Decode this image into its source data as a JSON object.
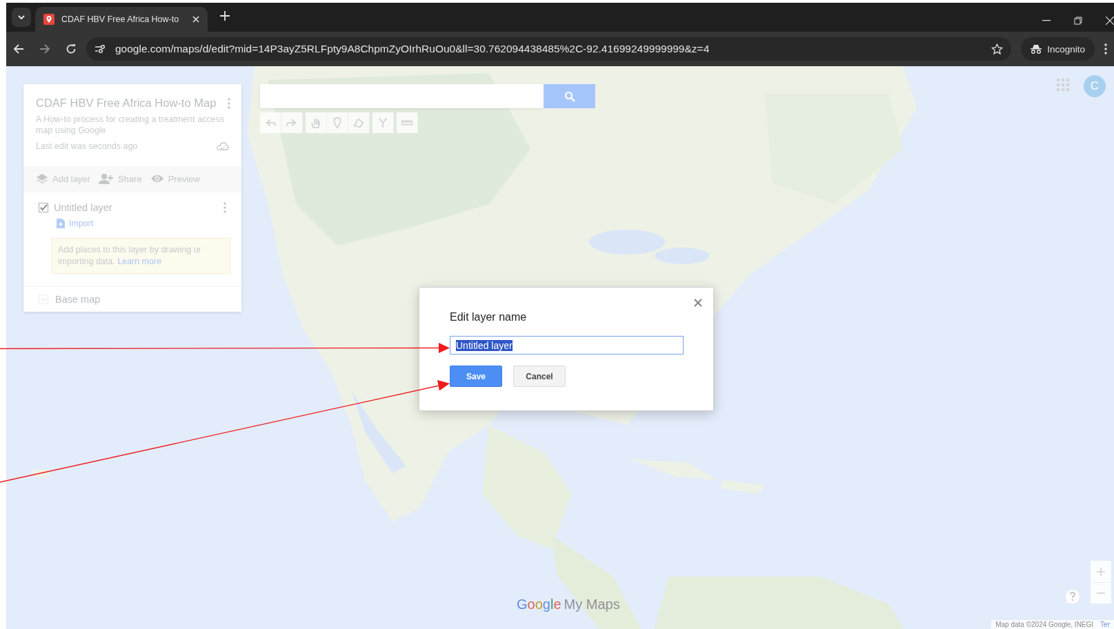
{
  "browser": {
    "tabs": [
      {
        "title": "CDAF HBV Free Africa How-to",
        "selected": true
      }
    ],
    "address": "google.com/maps/d/edit?mid=14P3ayZ5RLFpty9A8ChpmZyOIrhRuOu0&ll=30.762094438485%2C-92.41699249999999&z=4",
    "profile": "Incognito"
  },
  "map_panel": {
    "title": "CDAF HBV Free Africa How-to Map",
    "description": "A How-to process for creating a treatment access map using Google",
    "last_edit": "Last edit was seconds ago",
    "actions": [
      {
        "label": "Add layer",
        "kind": "layers"
      },
      {
        "label": "Share",
        "kind": "share"
      },
      {
        "label": "Preview",
        "kind": "preview"
      }
    ],
    "layers": [
      {
        "name": "Untitled layer",
        "checked": true,
        "import": "Import",
        "hint": "Add places to this layer by drawing or importing data.",
        "hint_link": "Learn more"
      }
    ],
    "base_map": "Base map"
  },
  "account": {
    "initial": "C"
  },
  "dialog": {
    "title": "Edit layer name",
    "value": "Untitled layer",
    "buttons": [
      {
        "label": "Save",
        "kind": "primary"
      },
      {
        "label": "Cancel",
        "kind": "secondary"
      }
    ]
  },
  "logo": {
    "brand": "Google",
    "product": "My Maps"
  },
  "attribution": {
    "text": "Map data ©2024 Google, INEGI",
    "link": "Ter"
  }
}
